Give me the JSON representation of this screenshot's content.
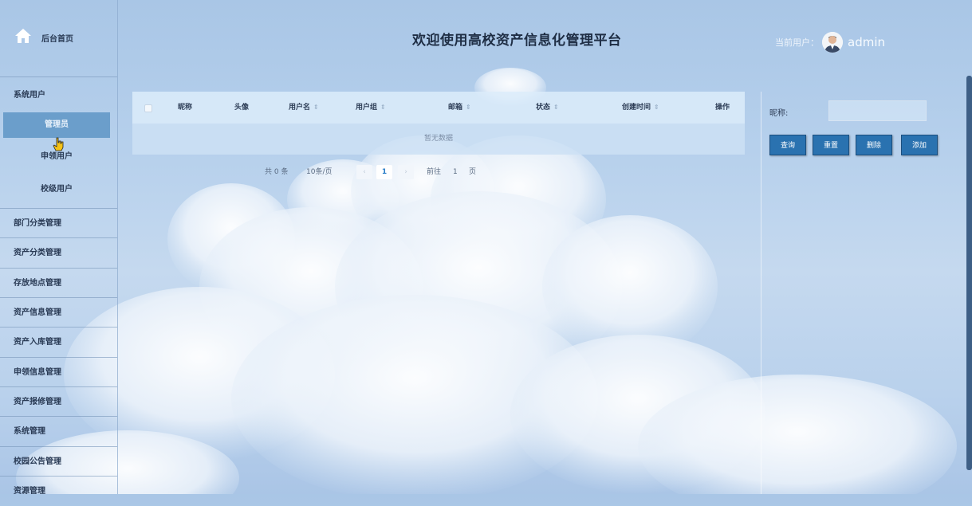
{
  "page": {
    "title": "欢迎使用高校资产信息化管理平台"
  },
  "user": {
    "label": "当前用户：",
    "name": "admin"
  },
  "sidebar": {
    "home_label": "后台首页",
    "group_title": "系统用户",
    "sub_items": [
      {
        "label": "管理员",
        "active": true
      },
      {
        "label": "申领用户",
        "active": false
      },
      {
        "label": "校级用户",
        "active": false
      }
    ],
    "items": [
      {
        "label": "部门分类管理"
      },
      {
        "label": "资产分类管理"
      },
      {
        "label": "存放地点管理"
      },
      {
        "label": "资产信息管理"
      },
      {
        "label": "资产入库管理"
      },
      {
        "label": "申领信息管理"
      },
      {
        "label": "资产报修管理"
      },
      {
        "label": "系统管理"
      },
      {
        "label": "校园公告管理"
      },
      {
        "label": "资源管理"
      }
    ]
  },
  "table": {
    "columns": [
      "昵称",
      "头像",
      "用户名",
      "用户组",
      "邮箱",
      "状态",
      "创建时间",
      "操作"
    ],
    "empty_text": "暂无数据"
  },
  "pagination": {
    "total": "共 0 条",
    "page_size": "10条/页",
    "current_page": "1",
    "goto_label": "前往",
    "goto_value": "1",
    "page_suffix": "页"
  },
  "search_panel": {
    "nickname_label": "昵称:",
    "nickname_value": "",
    "buttons": {
      "query": "查询",
      "reset": "重置",
      "delete": "删除",
      "add": "添加"
    }
  },
  "colors": {
    "button": "#2a72b0",
    "active_menu": "#6b9ecb"
  }
}
